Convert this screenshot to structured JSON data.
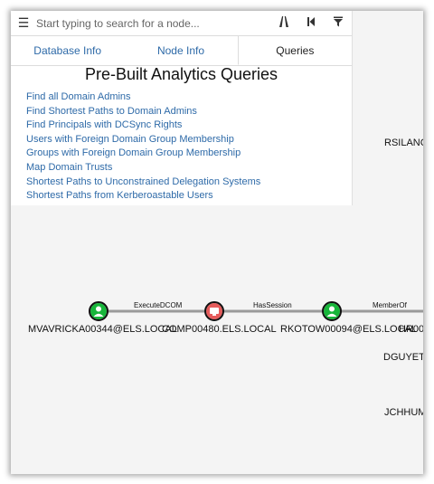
{
  "search": {
    "menu_icon": "hamburger-menu-icon",
    "placeholder": "Start typing to search for a node..."
  },
  "toolbar": {
    "path_icon": "road-icon",
    "back_icon": "step-back-icon",
    "filter_icon": "filter-icon"
  },
  "tabs": [
    {
      "label": "Database Info",
      "active": false
    },
    {
      "label": "Node Info",
      "active": false
    },
    {
      "label": "Queries",
      "active": true
    }
  ],
  "panel": {
    "title": "Pre-Built Analytics Queries",
    "queries": [
      "Find all Domain Admins",
      "Find Shortest Paths to Domain Admins",
      "Find Principals with DCSync Rights",
      "Users with Foreign Domain Group Membership",
      "Groups with Foreign Domain Group Membership",
      "Map Domain Trusts",
      "Shortest Paths to Unconstrained Delegation Systems",
      "Shortest Paths from Kerberoastable Users"
    ]
  },
  "graph": {
    "edges": [
      "ExecuteDCOM",
      "HasSession",
      "MemberOf"
    ],
    "nodes": [
      "MVAVRICKA00344@ELS.LOCAL",
      "COMP00480.ELS.LOCAL",
      "RKOTOW00094@ELS.LOCAL",
      "HR00"
    ],
    "side_labels": [
      "RSILANC",
      "DGUYETT",
      "JCHHUM"
    ],
    "colors": {
      "user_node": "#17b63a",
      "computer_node": "#e55b5b",
      "link": "#2e6aa8"
    }
  }
}
